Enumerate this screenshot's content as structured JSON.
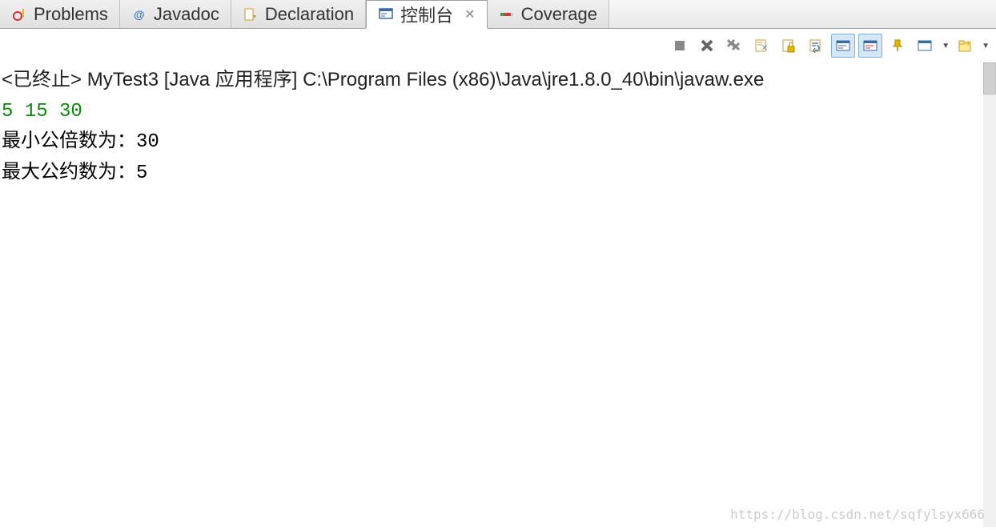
{
  "tabs": {
    "problems": {
      "label": "Problems"
    },
    "javadoc": {
      "label": "Javadoc"
    },
    "declaration": {
      "label": "Declaration"
    },
    "console": {
      "label": "控制台"
    },
    "coverage": {
      "label": "Coverage"
    }
  },
  "header": {
    "text": "<已终止> MyTest3 [Java 应用程序] C:\\Program Files (x86)\\Java\\jre1.8.0_40\\bin\\javaw.exe"
  },
  "console_lines": {
    "input": "5 15 30",
    "lcm": "最小公倍数为：30",
    "gcd": "最大公约数为：5"
  },
  "watermark": "https://blog.csdn.net/sqfylsyx666"
}
